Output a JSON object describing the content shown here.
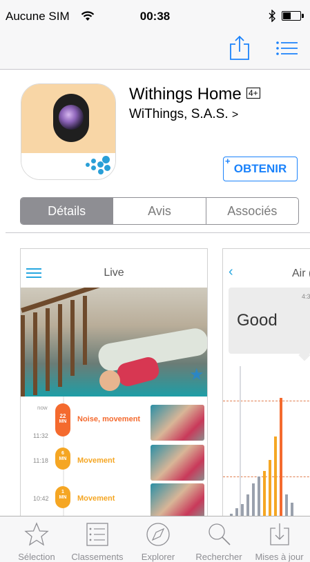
{
  "status_bar": {
    "carrier": "Aucune SIM",
    "time": "00:38"
  },
  "app": {
    "title": "Withings Home",
    "age_rating": "4+",
    "developer": "WiThings, S.A.S.",
    "developer_chevron": ">",
    "get_plus": "+",
    "get_button": "OBTENIR"
  },
  "segments": [
    {
      "label": "Détails"
    },
    {
      "label": "Avis"
    },
    {
      "label": "Associés"
    }
  ],
  "screenshot1": {
    "title": "Live",
    "events": [
      {
        "top_label": "now",
        "time": "11:32",
        "value": "22",
        "unit": "MN",
        "text": "Noise, movement",
        "color": "#f46a2e"
      },
      {
        "time": "11:18",
        "value": "6",
        "unit": "MN",
        "text": "Movement",
        "color": "#f5a623"
      },
      {
        "time": "10:42",
        "value": "1",
        "unit": "MN",
        "text": "Movement",
        "color": "#f5a623"
      }
    ]
  },
  "screenshot2": {
    "title": "Air (",
    "time": "4:3",
    "status": "Good"
  },
  "tabbar": {
    "items": [
      {
        "label": "Sélection"
      },
      {
        "label": "Classements"
      },
      {
        "label": "Explorer"
      },
      {
        "label": "Rechercher"
      },
      {
        "label": "Mises à jour"
      }
    ]
  },
  "colors": {
    "accent": "#1a82fb",
    "tab_gray": "#8e8e93",
    "app_blue": "#2a9fd7"
  }
}
